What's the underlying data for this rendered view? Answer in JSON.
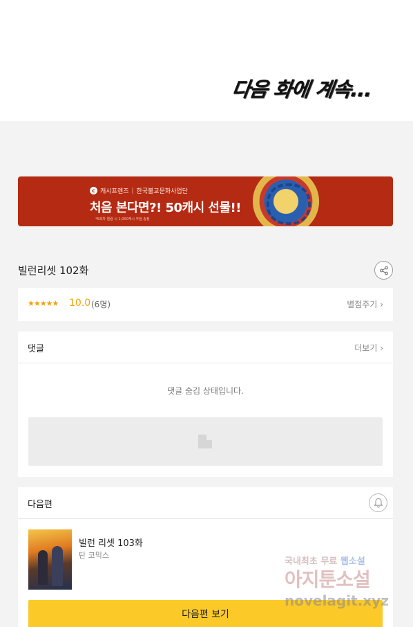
{
  "comic": {
    "continued_text": "다음 화에 계속..."
  },
  "banner": {
    "brand": "캐시프렌즈",
    "partner": "한국불교문화사업단",
    "headline": "처음 본다면?! 50캐시 선물!!",
    "fine_print": "*5회차 열람 시 1,000캐시 추첨 송정",
    "colors": {
      "background": "#b52a12"
    }
  },
  "episode": {
    "title": "빌런리셋 102화",
    "share_icon": "share-icon"
  },
  "rating": {
    "stars": "★★★★★",
    "score": "10.0",
    "count": "(6명)",
    "rate_link": "별점주기",
    "accent": "#f2a100"
  },
  "comments": {
    "title": "댓글",
    "more_link": "더보기",
    "hidden_message": "댓글 숨김 상태입니다."
  },
  "next": {
    "section_title": "다음편",
    "episode_title": "빌런 리셋 103화",
    "author": "탄 코믹스",
    "button_label": "다음편 보기",
    "button_color": "#fbc928",
    "bell_icon": "bell-icon"
  },
  "watermark": {
    "line1_a": "국내최초 무료",
    "line1_b": "웹소설",
    "line2": "아지툰소설",
    "line3": "novelagit.xyz"
  }
}
